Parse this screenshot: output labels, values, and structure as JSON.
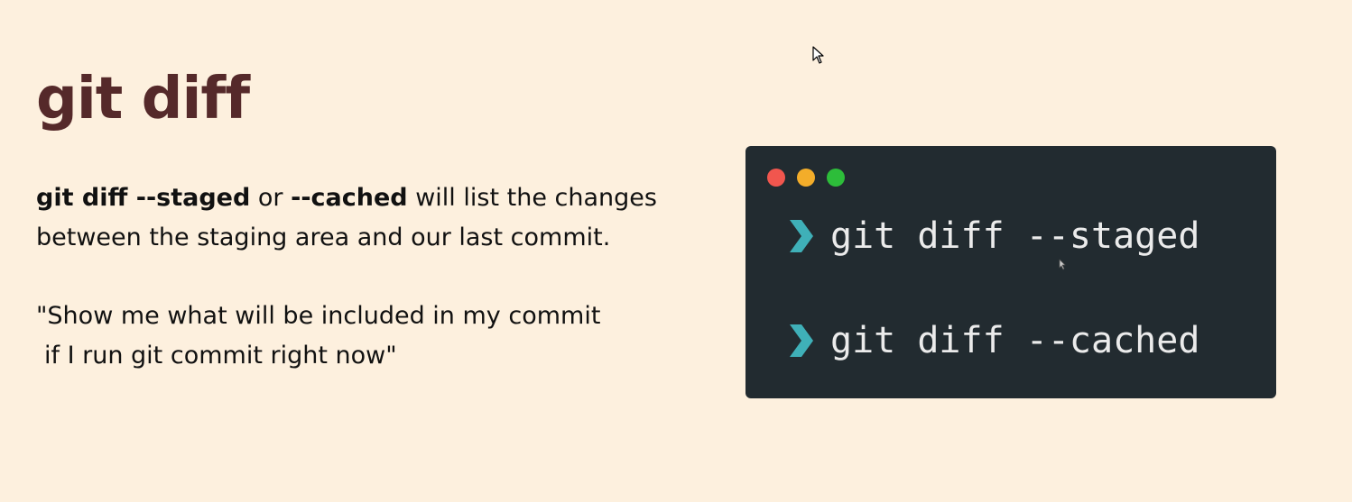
{
  "slide": {
    "title": "git diff",
    "paragraph": {
      "part1_bold": "git diff  --staged",
      "part2": " or ",
      "part3_bold": "--cached",
      "part4": " will list the changes between the staging area and our last commit."
    },
    "quote_line1": "\"Show me what will be included in my commit",
    "quote_line2": "if I run git commit right now\""
  },
  "terminal": {
    "commands": [
      "git diff --staged",
      "git diff --cached"
    ],
    "prompt_icon": "chevron-right-icon",
    "dot_colors": [
      "#f1564e",
      "#f3ad2a",
      "#2dbd3a"
    ],
    "prompt_color": "#3fb0b8",
    "background": "#222b30"
  },
  "colors": {
    "page_background": "#fdf0de",
    "title": "#55292a",
    "text": "#111111"
  }
}
